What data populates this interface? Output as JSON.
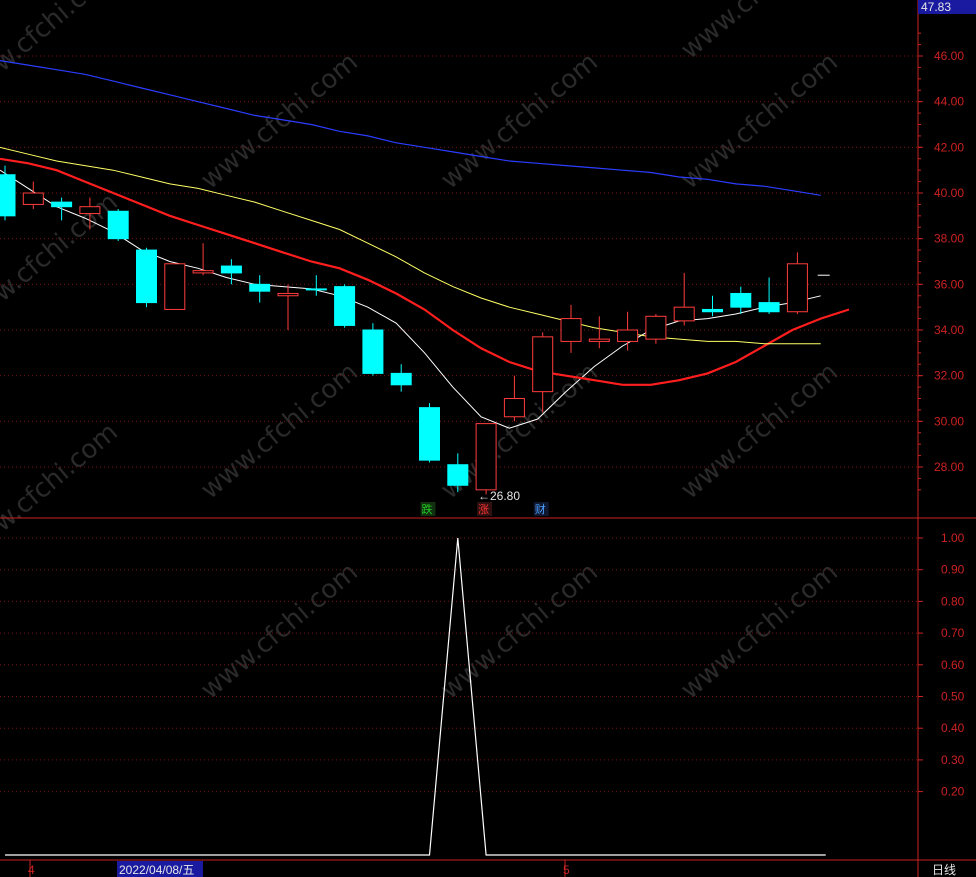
{
  "watermark": "www.cfchi.com",
  "price_panel": {
    "top_price_label": "47.83",
    "low_annotation": "←26.80",
    "badges": [
      {
        "text": "跌",
        "color": "#22cc22",
        "bg": "#103010",
        "index": 14
      },
      {
        "text": "涨",
        "color": "#ff3333",
        "bg": "#301010",
        "index": 16
      },
      {
        "text": "财",
        "color": "#4aa0ff",
        "bg": "#101830",
        "index": 18
      }
    ]
  },
  "bottom_bar": {
    "month_left": "4",
    "date_label": "2022/04/08/五",
    "month_right": "5",
    "period_label": "日线"
  },
  "colors": {
    "up": "#ff3c3c",
    "down": "#00ffff",
    "ma5": "#ffffff",
    "ma10": "#ff1e1e",
    "ma20": "#ffff66",
    "ma60": "#2b3dff",
    "grid": "#7a1010",
    "axis": "#cc2222"
  },
  "chart_data": [
    {
      "type": "candlestick",
      "title": "",
      "ylim": [
        26.5,
        47.83
      ],
      "y_ticks": [
        28.0,
        30.0,
        32.0,
        34.0,
        36.0,
        38.0,
        40.0,
        42.0,
        44.0,
        46.0
      ],
      "y_tick_labels": [
        "28.00",
        "30.00",
        "32.00",
        "34.00",
        "36.00",
        "38.00",
        "40.00",
        "42.00",
        "44.00",
        "46.00"
      ],
      "grid": true,
      "candles": [
        {
          "o": 40.8,
          "c": 39.0,
          "h": 41.2,
          "l": 38.8
        },
        {
          "o": 39.5,
          "c": 40.0,
          "h": 40.5,
          "l": 39.3
        },
        {
          "o": 39.6,
          "c": 39.4,
          "h": 39.8,
          "l": 38.8
        },
        {
          "o": 39.1,
          "c": 39.4,
          "h": 39.8,
          "l": 38.4
        },
        {
          "o": 39.2,
          "c": 38.0,
          "h": 39.3,
          "l": 37.9
        },
        {
          "o": 37.5,
          "c": 35.2,
          "h": 37.6,
          "l": 35.0
        },
        {
          "o": 34.9,
          "c": 36.9,
          "h": 36.9,
          "l": 34.9
        },
        {
          "o": 36.5,
          "c": 36.6,
          "h": 37.8,
          "l": 36.4
        },
        {
          "o": 36.8,
          "c": 36.5,
          "h": 37.1,
          "l": 36.0
        },
        {
          "o": 36.0,
          "c": 35.7,
          "h": 36.4,
          "l": 35.2
        },
        {
          "o": 35.5,
          "c": 35.6,
          "h": 36.0,
          "l": 34.0
        },
        {
          "o": 35.8,
          "c": 35.8,
          "h": 36.4,
          "l": 35.5
        },
        {
          "o": 35.9,
          "c": 34.2,
          "h": 36.0,
          "l": 34.1
        },
        {
          "o": 34.0,
          "c": 32.1,
          "h": 34.3,
          "l": 32.0
        },
        {
          "o": 32.1,
          "c": 31.6,
          "h": 32.5,
          "l": 31.3
        },
        {
          "o": 30.6,
          "c": 28.3,
          "h": 30.8,
          "l": 28.2
        },
        {
          "o": 28.1,
          "c": 27.2,
          "h": 28.6,
          "l": 26.9
        },
        {
          "o": 27.0,
          "c": 29.9,
          "h": 29.9,
          "l": 26.8
        },
        {
          "o": 30.2,
          "c": 31.0,
          "h": 32.0,
          "l": 30.0
        },
        {
          "o": 31.3,
          "c": 33.7,
          "h": 33.9,
          "l": 30.4
        },
        {
          "o": 33.5,
          "c": 34.5,
          "h": 35.1,
          "l": 33.0
        },
        {
          "o": 33.5,
          "c": 33.6,
          "h": 34.6,
          "l": 33.2
        },
        {
          "o": 33.5,
          "c": 34.0,
          "h": 34.8,
          "l": 33.1
        },
        {
          "o": 33.6,
          "c": 34.6,
          "h": 34.7,
          "l": 33.4
        },
        {
          "o": 34.4,
          "c": 35.0,
          "h": 36.5,
          "l": 34.2
        },
        {
          "o": 34.9,
          "c": 34.8,
          "h": 35.5,
          "l": 34.6
        },
        {
          "o": 35.6,
          "c": 35.0,
          "h": 35.9,
          "l": 34.7
        },
        {
          "o": 35.2,
          "c": 34.8,
          "h": 36.3,
          "l": 34.7
        },
        {
          "o": 34.8,
          "c": 36.9,
          "h": 37.4,
          "l": 34.7
        }
      ],
      "last_price": 36.4,
      "moving_averages": [
        {
          "key": "ma5",
          "values": [
            41.0,
            40.2,
            39.4,
            38.9,
            38.3,
            37.5,
            37.0,
            36.7,
            36.3,
            36.0,
            35.9,
            35.8,
            35.5,
            35.0,
            34.3,
            33.0,
            31.5,
            30.2,
            29.7,
            30.1,
            31.3,
            32.4,
            33.3,
            34.0,
            34.4,
            34.5,
            34.7,
            35.0,
            35.2,
            35.5
          ]
        },
        {
          "key": "ma10",
          "values": [
            41.5,
            41.3,
            41.0,
            40.5,
            40.0,
            39.5,
            39.0,
            38.6,
            38.2,
            37.8,
            37.4,
            37.0,
            36.7,
            36.2,
            35.6,
            34.9,
            34.0,
            33.2,
            32.6,
            32.2,
            32.0,
            31.8,
            31.6,
            31.6,
            31.8,
            32.1,
            32.6,
            33.3,
            34.0,
            34.5,
            34.9
          ]
        },
        {
          "key": "ma20",
          "values": [
            42.0,
            41.7,
            41.4,
            41.2,
            41.0,
            40.7,
            40.4,
            40.2,
            39.9,
            39.6,
            39.2,
            38.8,
            38.4,
            37.8,
            37.2,
            36.5,
            35.9,
            35.4,
            35.0,
            34.7,
            34.4,
            34.1,
            33.9,
            33.7,
            33.6,
            33.5,
            33.5,
            33.4,
            33.4,
            33.4
          ]
        },
        {
          "key": "ma60",
          "values": [
            45.8,
            45.6,
            45.4,
            45.2,
            44.9,
            44.6,
            44.3,
            44.0,
            43.7,
            43.4,
            43.2,
            43.0,
            42.7,
            42.5,
            42.2,
            42.0,
            41.8,
            41.6,
            41.4,
            41.3,
            41.2,
            41.1,
            41.0,
            40.9,
            40.7,
            40.6,
            40.4,
            40.3,
            40.1,
            39.9
          ]
        }
      ]
    },
    {
      "type": "line",
      "title": "",
      "ylim": [
        0,
        1.05
      ],
      "y_ticks": [
        0.2,
        0.3,
        0.4,
        0.5,
        0.6,
        0.7,
        0.8,
        0.9,
        1.0
      ],
      "y_tick_labels": [
        "0.20",
        "0.30",
        "0.40",
        "0.50",
        "0.60",
        "0.70",
        "0.80",
        "0.90",
        "1.00"
      ],
      "grid": true,
      "series": [
        {
          "values": [
            0,
            0,
            0,
            0,
            0,
            0,
            0,
            0,
            0,
            0,
            0,
            0,
            0,
            0,
            0,
            0,
            1,
            0,
            0,
            0,
            0,
            0,
            0,
            0,
            0,
            0,
            0,
            0,
            0,
            0
          ]
        }
      ]
    }
  ]
}
